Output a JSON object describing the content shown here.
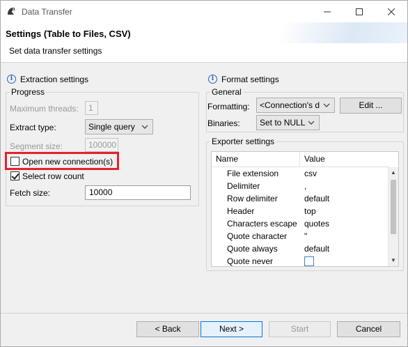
{
  "window": {
    "title": "Data Transfer"
  },
  "banner": {
    "title": "Settings (Table to Files, CSV)",
    "subtitle": "Set data transfer settings"
  },
  "extraction": {
    "title": "Extraction settings",
    "group": "Progress",
    "max_threads_label": "Maximum threads:",
    "max_threads_value": "1",
    "extract_type_label": "Extract type:",
    "extract_type_value": "Single query",
    "segment_size_label": "Segment size:",
    "segment_size_value": "100000",
    "open_new_connection_label": "Open new connection(s)",
    "open_new_connection_checked": false,
    "select_row_count_label": "Select row count",
    "select_row_count_checked": true,
    "fetch_size_label": "Fetch size:",
    "fetch_size_value": "10000"
  },
  "format": {
    "title": "Format settings",
    "group": "General",
    "formatting_label": "Formatting:",
    "formatting_value": "<Connection's d",
    "edit_button": "Edit ...",
    "binaries_label": "Binaries:",
    "binaries_value": "Set to NULL"
  },
  "exporter": {
    "title": "Exporter settings",
    "columns": [
      "Name",
      "Value"
    ],
    "rows": [
      {
        "name": "File extension",
        "value": "csv"
      },
      {
        "name": "Delimiter",
        "value": ","
      },
      {
        "name": "Row delimiter",
        "value": "default"
      },
      {
        "name": "Header",
        "value": "top"
      },
      {
        "name": "Characters escape",
        "value": "quotes"
      },
      {
        "name": "Quote character",
        "value": "\""
      },
      {
        "name": "Quote always",
        "value": "default"
      },
      {
        "name": "Quote never",
        "value": ""
      }
    ]
  },
  "footer": {
    "back": "< Back",
    "next": "Next >",
    "start": "Start",
    "cancel": "Cancel"
  }
}
